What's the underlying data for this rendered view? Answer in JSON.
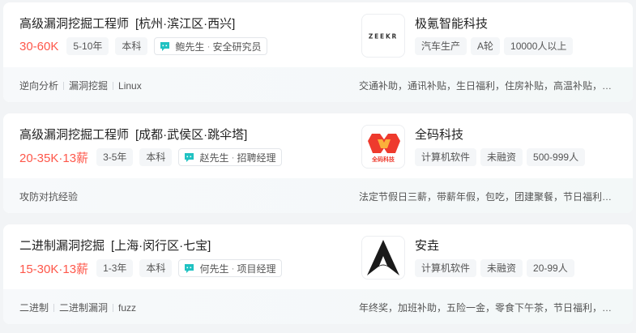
{
  "jobs": [
    {
      "title": "高级漏洞挖掘工程师",
      "area": "[杭州·滨江区·西兴]",
      "salary": "30-60K",
      "experience": "5-10年",
      "degree": "本科",
      "boss_name": "鲍先生",
      "boss_title": "安全研究员",
      "skills": [
        "逆向分析",
        "漏洞挖掘",
        "Linux"
      ],
      "company": {
        "name": "极氪智能科技",
        "logo_text": "ZEEKR",
        "tags": [
          "汽车生产",
          "A轮",
          "10000人以上"
        ]
      },
      "welfare": "交通补助，通讯补贴，生日福利，住房补贴，高温补贴，五险一金"
    },
    {
      "title": "高级漏洞挖掘工程师",
      "area": "[成都·武侯区·跳伞塔]",
      "salary": "20-35K·13薪",
      "experience": "3-5年",
      "degree": "本科",
      "boss_name": "赵先生",
      "boss_title": "招聘经理",
      "skills": [
        "攻防对抗经验"
      ],
      "company": {
        "name": "全码科技",
        "logo_text": "全码科技",
        "tags": [
          "计算机软件",
          "未融资",
          "500-999人"
        ]
      },
      "welfare": "法定节假日三薪，带薪年假，包吃，团建聚餐，节日福利，定期体检"
    },
    {
      "title": "二进制漏洞挖掘",
      "area": "[上海·闵行区·七宝]",
      "salary": "15-30K·13薪",
      "experience": "1-3年",
      "degree": "本科",
      "boss_name": "何先生",
      "boss_title": "项目经理",
      "skills": [
        "二进制",
        "二进制漏洞",
        "fuzz"
      ],
      "company": {
        "name": "安垚",
        "logo_text": "",
        "tags": [
          "计算机软件",
          "未融资",
          "20-99人"
        ]
      },
      "welfare": "年终奖，加班补助，五险一金，零食下午茶，节日福利，带薪年假"
    }
  ],
  "colors": {
    "salary": "#fe574a",
    "chat_icon": "#1fc2c2",
    "page_bg": "#f2f4f6"
  },
  "icons": {
    "chat": "chat-bubble-icon"
  }
}
